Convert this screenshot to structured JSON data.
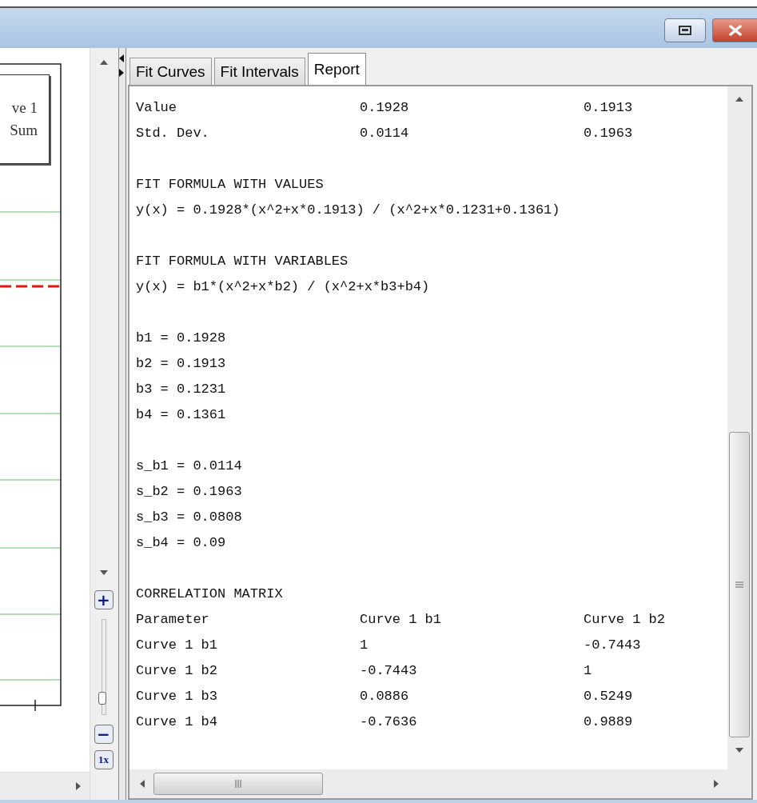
{
  "plot": {
    "legend": [
      "ve 1",
      "Sum"
    ]
  },
  "zoom": {
    "plus": "+",
    "minus": "−",
    "reset": "1x",
    "level": 0.1
  },
  "tabs": [
    {
      "label": "Fit Curves",
      "selected": false
    },
    {
      "label": "Fit Intervals",
      "selected": false
    },
    {
      "label": "Report",
      "selected": true
    }
  ],
  "report": {
    "sections": [
      {
        "lines": [
          [
            "Value",
            "0.1928",
            "0.1913"
          ],
          [
            "Std. Dev.",
            "0.0114",
            "0.1963"
          ]
        ]
      },
      {
        "lines": [
          [
            "FIT FORMULA WITH VALUES"
          ],
          [
            "y(x) = 0.1928*(x^2+x*0.1913) / (x^2+x*0.1231+0.1361)"
          ]
        ]
      },
      {
        "lines": [
          [
            "FIT FORMULA WITH VARIABLES"
          ],
          [
            "y(x) = b1*(x^2+x*b2) / (x^2+x*b3+b4)"
          ]
        ]
      },
      {
        "lines": [
          [
            "b1 = 0.1928"
          ],
          [
            "b2 = 0.1913"
          ],
          [
            "b3 = 0.1231"
          ],
          [
            "b4 = 0.1361"
          ]
        ]
      },
      {
        "lines": [
          [
            "s_b1 = 0.0114"
          ],
          [
            "s_b2 = 0.1963"
          ],
          [
            "s_b3 = 0.0808"
          ],
          [
            "s_b4 = 0.09"
          ]
        ]
      },
      {
        "lines": [
          [
            "CORRELATION MATRIX"
          ],
          [
            "Parameter",
            "Curve 1 b1",
            "Curve 1 b2"
          ],
          [
            "Curve 1 b1",
            "1",
            "-0.7443"
          ],
          [
            "Curve 1 b2",
            "-0.7443",
            "1"
          ],
          [
            "Curve 1 b3",
            "0.0886",
            "0.5249"
          ],
          [
            "Curve 1 b4",
            "-0.7636",
            "0.9889"
          ]
        ]
      }
    ]
  }
}
